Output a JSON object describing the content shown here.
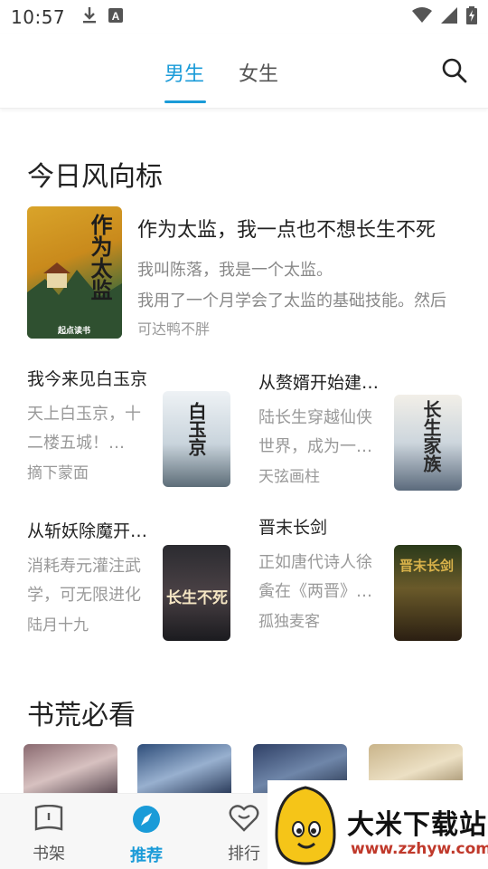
{
  "status_bar": {
    "time": "10:57",
    "icons": [
      "download-icon",
      "a-badge-icon",
      "wifi-icon",
      "signal-icon",
      "battery-charging-icon"
    ]
  },
  "top_tabs": [
    {
      "label": "男生",
      "active": true
    },
    {
      "label": "女生",
      "active": false
    }
  ],
  "accent_color": "#1a9bd8",
  "section1": {
    "title": "今日风向标",
    "featured": {
      "title": "作为太监，我一点也不想长生不死",
      "desc_line1": "我叫陈落，我是一个太监。",
      "desc_line2": "我用了一个月学会了太监的基础技能。然后",
      "author": "可达鸭不胖",
      "cover_text": "作为太监",
      "cover_publisher": "起点读书"
    },
    "books": [
      {
        "title": "我今来见白玉京",
        "desc1": "天上白玉京，十",
        "desc2": "二楼五城！…",
        "author": "摘下蒙面",
        "cover_text": "白玉京"
      },
      {
        "title": "从赘婿开始建立长生家族",
        "desc1": "陆长生穿越仙侠",
        "desc2": "世界，成为一个赘婿",
        "author": "天弦画柱",
        "cover_text": "长生家族"
      },
      {
        "title": "从斩妖除魔开始长生不死",
        "desc1": "消耗寿元灌注武",
        "desc2": "学，可无限进化",
        "author": "陆月十九",
        "cover_text": "长生不死"
      },
      {
        "title": "晋末长剑",
        "desc1": "正如唐代诗人徐",
        "desc2": "夤在《两晋》诗中",
        "author": "孤独麦客",
        "cover_text": "晋末长剑"
      }
    ]
  },
  "section2": {
    "title": "书荒必看"
  },
  "bottom_nav": [
    {
      "label": "书架",
      "icon": "book-icon",
      "active": false
    },
    {
      "label": "推荐",
      "icon": "compass-icon",
      "active": true
    },
    {
      "label": "排行",
      "icon": "heart-rank-icon",
      "active": false
    }
  ],
  "watermark": {
    "title": "大米下载站",
    "url": "www.zzhyw.com"
  }
}
